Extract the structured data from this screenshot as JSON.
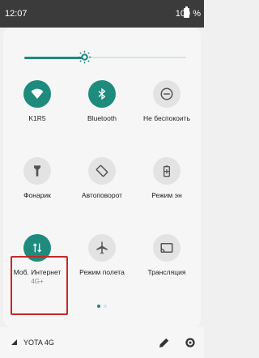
{
  "status_bar": {
    "time": "12:07",
    "battery": "100 %"
  },
  "brightness": {
    "level_percent": 37
  },
  "tiles": [
    {
      "label": "K1R5",
      "icon": "wifi-icon",
      "state": "on"
    },
    {
      "label": "Bluetooth",
      "icon": "bluetooth-icon",
      "state": "on"
    },
    {
      "label": "Не беспокоить",
      "icon": "dnd-icon",
      "state": "off"
    },
    {
      "label": "Фонарик",
      "icon": "flashlight-icon",
      "state": "off"
    },
    {
      "label": "Автоповорот",
      "icon": "rotate-icon",
      "state": "off"
    },
    {
      "label": "Режим эн",
      "icon": "battery-saver-icon",
      "state": "off"
    },
    {
      "label": "Моб. Интернет",
      "sublabel": "4G+",
      "icon": "mobile-data-icon",
      "state": "on"
    },
    {
      "label": "Режим полета",
      "icon": "airplane-icon",
      "state": "off"
    },
    {
      "label": "Трансляция",
      "icon": "cast-icon",
      "state": "off"
    }
  ],
  "pager": {
    "pages": 2,
    "current": 1
  },
  "footer": {
    "carrier": "YOTA 4G"
  },
  "colors": {
    "accent": "#1e8b7d",
    "inactive": "#e3e3e3",
    "highlight": "#c62828"
  }
}
